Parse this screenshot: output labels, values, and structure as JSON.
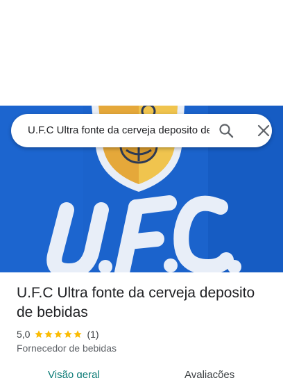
{
  "search": {
    "value": "U.F.C Ultra fonte da cerveja deposito de bebidas",
    "search_icon": "search-icon",
    "close_icon": "close-icon"
  },
  "hero": {
    "sign_text": "U.F.C."
  },
  "place": {
    "title": "U.F.C Ultra fonte da cerveja deposito de bebidas",
    "rating": "5,0",
    "stars": 5,
    "review_count": "(1)",
    "category": "Fornecedor de bebidas"
  },
  "tabs": [
    {
      "label": "Visão geral",
      "active": true
    },
    {
      "label": "Avaliações",
      "active": false
    }
  ],
  "colors": {
    "accent": "#0b7b76",
    "star": "#fbbc04",
    "sign_blue": "#1a5fc4"
  }
}
